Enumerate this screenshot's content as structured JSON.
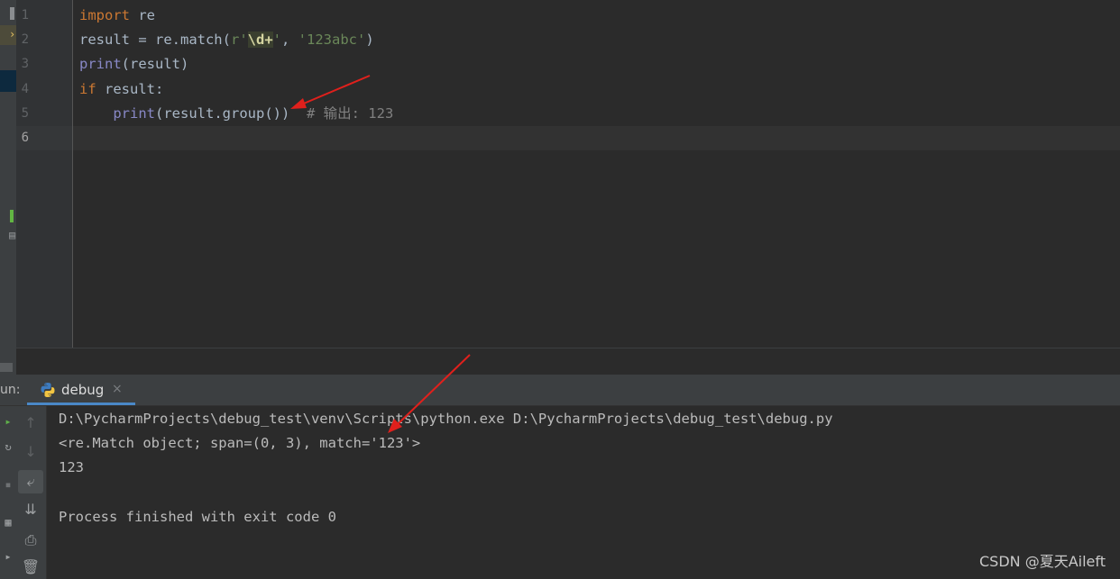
{
  "editor": {
    "line_numbers": [
      "1",
      "2",
      "3",
      "4",
      "5",
      "6"
    ],
    "code": {
      "l1_kw": "import",
      "l1_rest": " re",
      "l2_a": "result = re.match(",
      "l2_str_open": "r'",
      "l2_regex": "\\d+",
      "l2_str_close": "'",
      "l2_sep": ", ",
      "l2_str2": "'123abc'",
      "l2_close": ")",
      "l3_fn": "print",
      "l3_rest": "(result)",
      "l4_kw": "if",
      "l4_rest": " result:",
      "l5_indent": "    ",
      "l5_fn": "print",
      "l5_rest": "(result.group())",
      "l5_comment": "  # 输出: 123"
    }
  },
  "run_window": {
    "label": "un:",
    "tab_name": "debug",
    "tab_close": "×"
  },
  "console": {
    "lines": [
      "D:\\PycharmProjects\\debug_test\\venv\\Scripts\\python.exe D:\\PycharmProjects\\debug_test\\debug.py",
      "<re.Match object; span=(0, 3), match='123'>",
      "123",
      "",
      "Process finished with exit code 0"
    ]
  },
  "watermark": "CSDN @夏天Aileft",
  "icons": {
    "tab": "python-icon",
    "toolbar": [
      "arrow-up-icon",
      "arrow-down-icon",
      "soft-wrap-icon",
      "scroll-to-end-icon",
      "print-icon",
      "trash-icon"
    ]
  },
  "colors": {
    "annotation_arrow": "#e0201c",
    "tab_underline": "#4a88c7"
  }
}
